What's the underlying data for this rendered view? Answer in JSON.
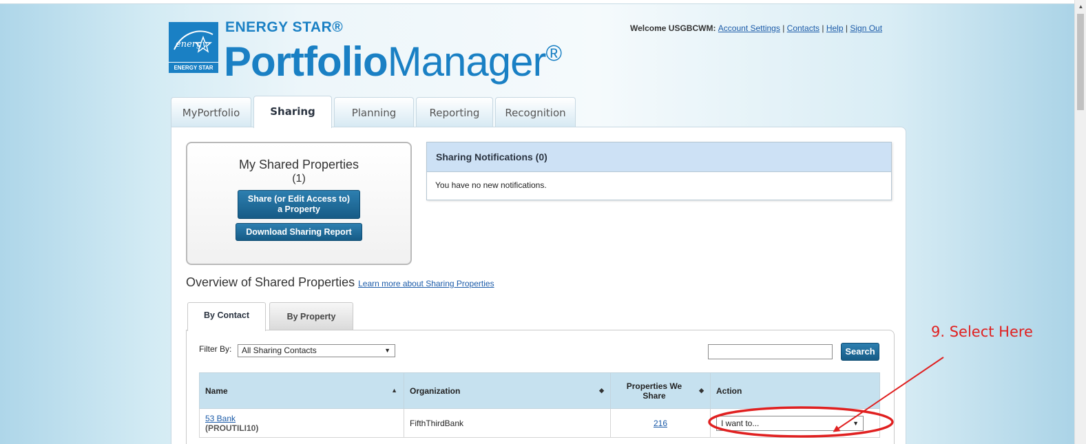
{
  "header": {
    "logo": {
      "brand_top": "ENERGY STAR®",
      "brand_bold": "Portfolio",
      "brand_light": "Manager",
      "brand_mark": "®",
      "badge_text": "ENERGY STAR"
    },
    "welcome_prefix": "Welcome USGBCWM:",
    "links": [
      "Account Settings",
      "Contacts",
      "Help",
      "Sign Out"
    ]
  },
  "main_tabs": [
    {
      "label": "MyPortfolio",
      "active": false
    },
    {
      "label": "Sharing",
      "active": true
    },
    {
      "label": "Planning",
      "active": false
    },
    {
      "label": "Reporting",
      "active": false
    },
    {
      "label": "Recognition",
      "active": false
    }
  ],
  "shared_properties": {
    "title": "My Shared Properties",
    "count": "(1)",
    "share_button_line1": "Share (or Edit Access to)",
    "share_button_line2": "a Property",
    "download_button": "Download Sharing Report"
  },
  "notifications": {
    "title": "Sharing Notifications (0)",
    "body": "You have no new notifications."
  },
  "overview": {
    "title": "Overview of Shared Properties",
    "learn_more": "Learn more about Sharing Properties"
  },
  "sub_tabs": [
    {
      "label": "By Contact",
      "active": true
    },
    {
      "label": "By Property",
      "active": false
    }
  ],
  "filter": {
    "label": "Filter By:",
    "selected": "All Sharing Contacts"
  },
  "search": {
    "value": "",
    "button": "Search"
  },
  "table": {
    "columns": [
      "Name",
      "Organization",
      "Properties We Share",
      "Action"
    ],
    "rows": [
      {
        "name": "53 Bank",
        "account": "(PROUTILI10)",
        "organization": "FifthThirdBank",
        "properties": "216",
        "action": "I want to..."
      }
    ]
  },
  "annotation": {
    "label": "9. Select Here",
    "color": "#e02020"
  },
  "colors": {
    "brand_blue": "#1a80c4",
    "button_blue": "#165b86",
    "header_row": "#c6e1ef",
    "link": "#1a5aa8"
  }
}
